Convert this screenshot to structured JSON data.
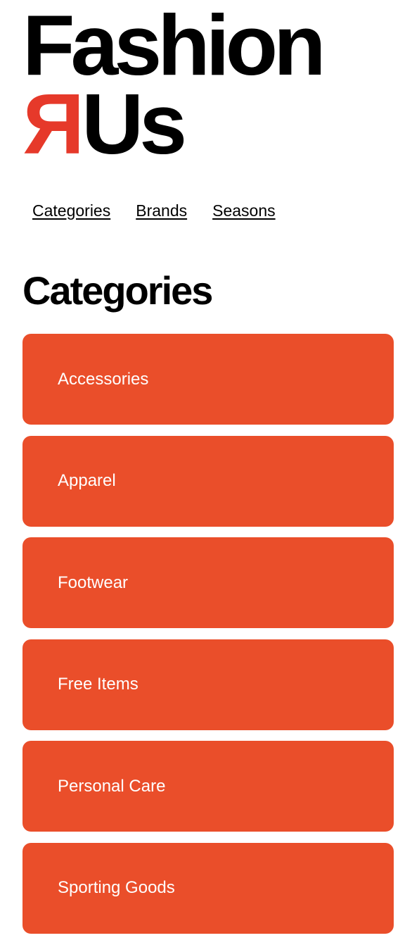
{
  "brand": {
    "line1": "Fashion",
    "r_mark": "R",
    "line2_rest": "Us"
  },
  "nav": {
    "items": [
      "Categories",
      "Brands",
      "Seasons"
    ]
  },
  "section_title": "Categories",
  "categories": [
    "Accessories",
    "Apparel",
    "Footwear",
    "Free Items",
    "Personal Care",
    "Sporting Goods"
  ],
  "colors": {
    "accent": "#ea4e2a",
    "logo_r": "#e6392a",
    "text": "#000000",
    "card_text": "#ffffff",
    "background": "#ffffff"
  }
}
